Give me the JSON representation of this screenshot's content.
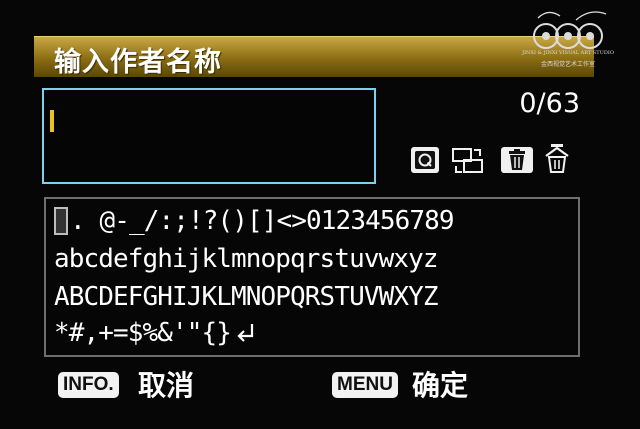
{
  "title": "输入作者名称",
  "counter": "0/63",
  "input": {
    "value": ""
  },
  "icons": {
    "q": "q-button-icon",
    "switch": "switch-palette-icon",
    "delete": "trash-icon",
    "erase": "erase-all-icon",
    "enter": "return-arrow-icon"
  },
  "characters": {
    "row1": ". @-_/:;!?()[]<>0123456789",
    "row2": "abcdefghijklmnopqrstuvwxyz",
    "row3": "ABCDEFGHIJKLMNOPQRSTUVWXYZ",
    "row4": "*#,+=$%&'\"{}"
  },
  "footer": {
    "info_key": "INFO.",
    "info_action": "取消",
    "menu_key": "MENU",
    "menu_action": "确定"
  },
  "watermark": {
    "caption": "JINXI & JINXI VISUAL ART STUDIO",
    "sub": "金西视觉艺术工作室"
  },
  "colors": {
    "title_bar": "#a88a2a",
    "input_border": "#7fd0ea",
    "cursor": "#e9c21b",
    "panel_border": "#6e6e6e"
  }
}
